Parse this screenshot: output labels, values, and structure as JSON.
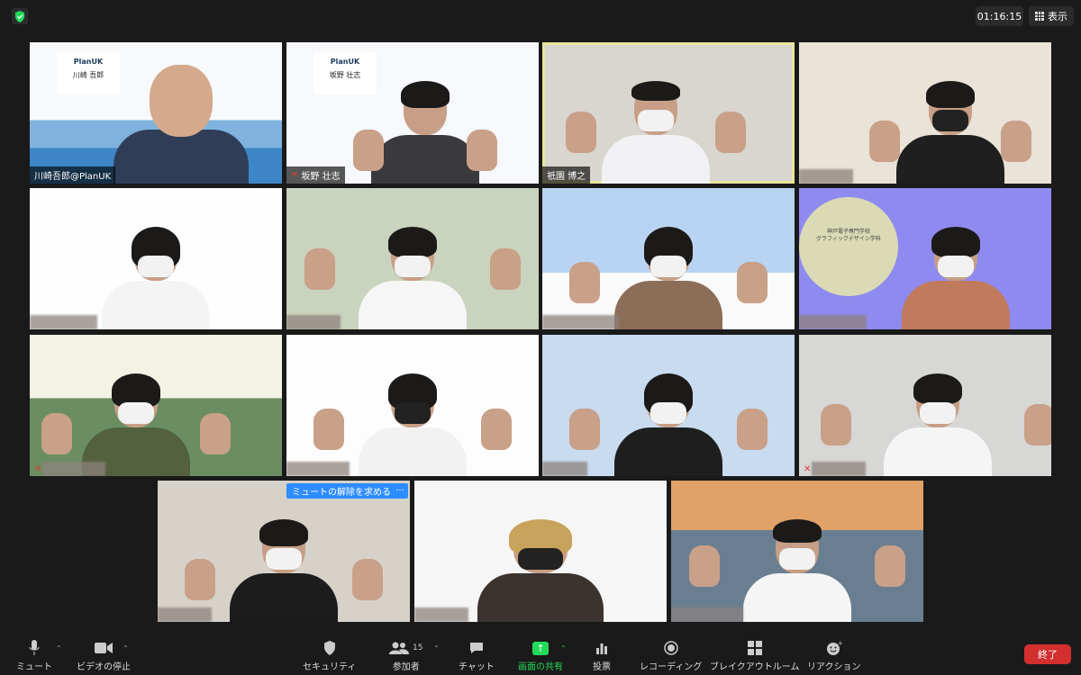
{
  "topbar": {
    "timer": "01:16:15",
    "view_label": "表示"
  },
  "tiles": {
    "t1": {
      "name": "川崎吾郎@PlanUK",
      "logo": "PlanUK",
      "card_name": "川崎 吾郎"
    },
    "t2": {
      "name": "坂野 壮志",
      "logo": "PlanUK",
      "card_name": "坂野 壮志"
    },
    "t3": {
      "name": "祇園 博之"
    },
    "t8": {
      "banner_line1": "神戸電子専門学校",
      "banner_line2": "グラフィックデザイン学科"
    }
  },
  "unmute_request": {
    "label": "ミュートの解除を求める",
    "more": "···"
  },
  "toolbar": {
    "mute": "ミュート",
    "video": "ビデオの停止",
    "security": "セキュリティ",
    "participants": "参加者",
    "participants_count": "15",
    "chat": "チャット",
    "share": "画面の共有",
    "poll": "投票",
    "record": "レコーディング",
    "breakout": "ブレイクアウトルーム",
    "reactions": "リアクション",
    "end": "終了"
  },
  "colors": {
    "accent_green": "#23d959",
    "end_red": "#d32f2f",
    "active_speaker": "#e8e79a",
    "request_blue": "#2d8cff"
  },
  "icons": [
    "shield-check-icon",
    "grid-icon",
    "microphone-icon",
    "video-camera-icon",
    "shield-icon",
    "people-icon",
    "chat-bubble-icon",
    "share-arrow-icon",
    "bar-chart-icon",
    "record-icon",
    "breakout-grid-icon",
    "emoji-add-icon"
  ]
}
